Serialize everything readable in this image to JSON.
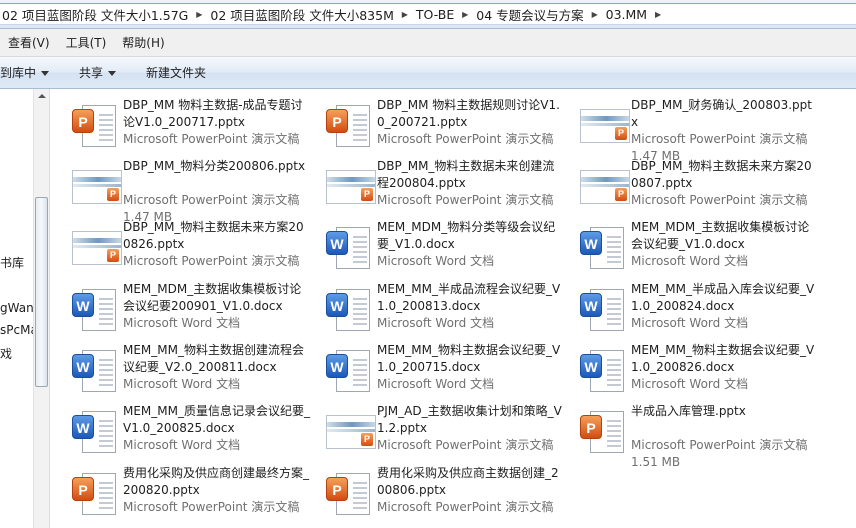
{
  "breadcrumbs": [
    "02 项目蓝图阶段 文件大小1.57G",
    "02 项目蓝图阶段 文件大小835M",
    "TO-BE",
    "04 专题会议与方案",
    "03.MM"
  ],
  "menu": [
    "查看(V)",
    "工具(T)",
    "帮助(H)"
  ],
  "toolbar": {
    "include_in_library": "到库中",
    "share": "共享",
    "new_folder": "新建文件夹"
  },
  "nav": {
    "items": [
      "书库",
      "gWan",
      "sPcMa",
      "戏"
    ]
  },
  "files": [
    {
      "name": "DBP_MM 物料主数据-成品专题讨论V1.0_200717.pptx",
      "type": "Microsoft PowerPoint 演示文稿",
      "size": "",
      "icon": "powerpoint-icon"
    },
    {
      "name": "DBP_MM 物料主数据规则讨论V1.0_200721.pptx",
      "type": "Microsoft PowerPoint 演示文稿",
      "size": "",
      "icon": "powerpoint-icon"
    },
    {
      "name": "DBP_MM_财务确认_200803.pptx",
      "type": "Microsoft PowerPoint 演示文稿",
      "size": "1.47 MB",
      "icon": "slide-thumbnail-icon"
    },
    {
      "name": "DBP_MM_物料分类200806.pptx",
      "type": "Microsoft PowerPoint 演示文稿",
      "size": "1.47 MB",
      "icon": "slide-thumbnail-icon"
    },
    {
      "name": "DBP_MM_物料主数据未来创建流程200804.pptx",
      "type": "Microsoft PowerPoint 演示文稿",
      "size": "",
      "icon": "slide-thumbnail-icon"
    },
    {
      "name": "DBP_MM_物料主数据未来方案200807.pptx",
      "type": "Microsoft PowerPoint 演示文稿",
      "size": "",
      "icon": "slide-thumbnail-icon"
    },
    {
      "name": "DBP_MM_物料主数据未来方案200826.pptx",
      "type": "Microsoft PowerPoint 演示文稿",
      "size": "",
      "icon": "slide-thumbnail-icon"
    },
    {
      "name": "MEM_MDM_物料分类等级会议纪要_V1.0.docx",
      "type": "Microsoft Word 文档",
      "size": "",
      "icon": "word-icon"
    },
    {
      "name": "MEM_MDM_主数据收集模板讨论会议纪要_V1.0.docx",
      "type": "Microsoft Word 文档",
      "size": "",
      "icon": "word-icon"
    },
    {
      "name": "MEM_MDM_主数据收集模板讨论会议纪要200901_V1.0.docx",
      "type": "Microsoft Word 文档",
      "size": "",
      "icon": "word-icon"
    },
    {
      "name": "MEM_MM_半成品流程会议纪要_V1.0_200813.docx",
      "type": "Microsoft Word 文档",
      "size": "",
      "icon": "word-icon"
    },
    {
      "name": "MEM_MM_半成品入库会议纪要_V1.0_200824.docx",
      "type": "Microsoft Word 文档",
      "size": "",
      "icon": "word-icon"
    },
    {
      "name": "MEM_MM_物料主数据创建流程会议纪要_V2.0_200811.docx",
      "type": "Microsoft Word 文档",
      "size": "",
      "icon": "word-icon"
    },
    {
      "name": "MEM_MM_物料主数据会议纪要_V1.0_200715.docx",
      "type": "Microsoft Word 文档",
      "size": "",
      "icon": "word-icon"
    },
    {
      "name": "MEM_MM_物料主数据会议纪要_V1.0_200826.docx",
      "type": "Microsoft Word 文档",
      "size": "",
      "icon": "word-icon"
    },
    {
      "name": "MEM_MM_质量信息记录会议纪要_V1.0_200825.docx",
      "type": "Microsoft Word 文档",
      "size": "",
      "icon": "word-icon"
    },
    {
      "name": "PJM_AD_主数据收集计划和策略_V1.2.pptx",
      "type": "Microsoft PowerPoint 演示文稿",
      "size": "",
      "icon": "slide-thumbnail-icon"
    },
    {
      "name": "半成品入库管理.pptx",
      "type": "Microsoft PowerPoint 演示文稿",
      "size": "1.51 MB",
      "icon": "powerpoint-icon"
    },
    {
      "name": "费用化采购及供应商创建最终方案_200820.pptx",
      "type": "Microsoft PowerPoint 演示文稿",
      "size": "",
      "icon": "powerpoint-icon"
    },
    {
      "name": "费用化采购及供应商主数据创建_200806.pptx",
      "type": "Microsoft PowerPoint 演示文稿",
      "size": "",
      "icon": "powerpoint-icon"
    }
  ]
}
